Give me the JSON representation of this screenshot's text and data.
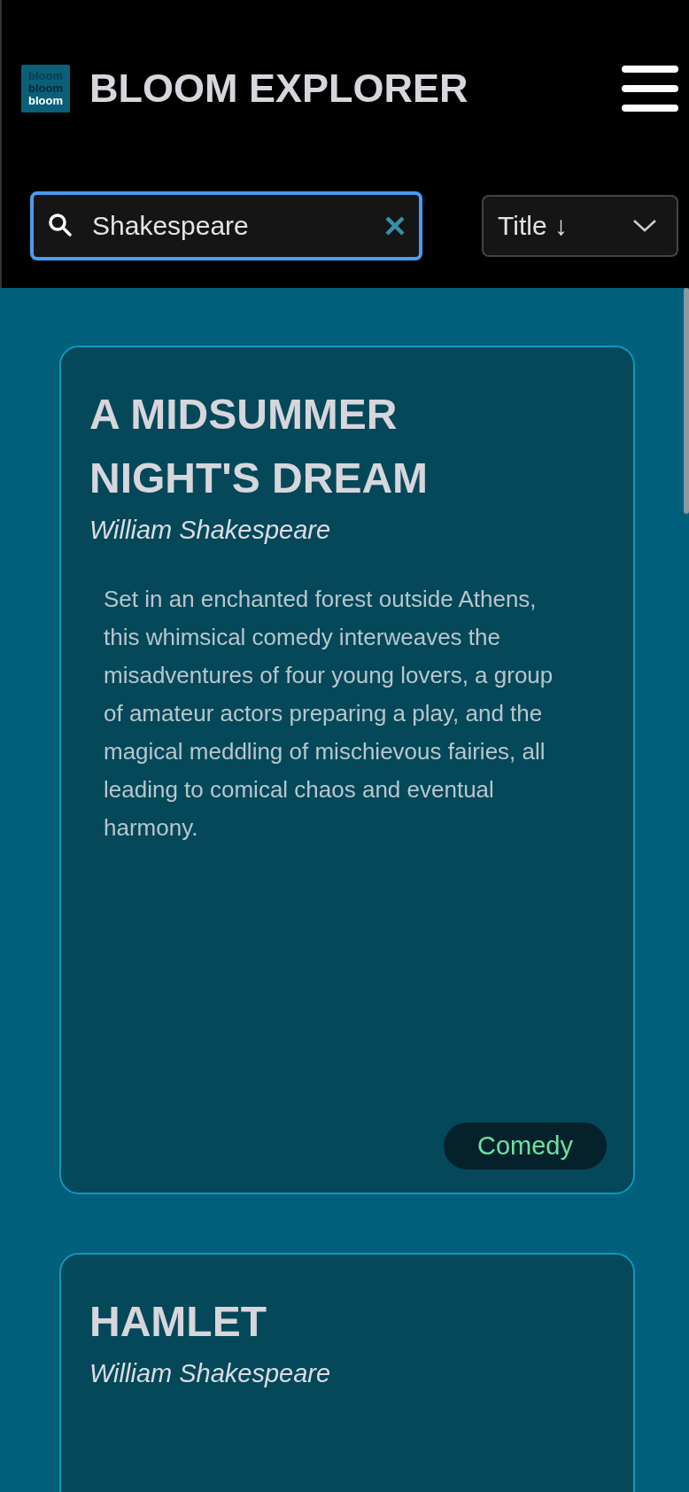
{
  "header": {
    "logo_words": [
      "bloom",
      "bloom",
      "bloom"
    ],
    "title": "BLOOM EXPLORER"
  },
  "search": {
    "value": "Shakespeare"
  },
  "sort": {
    "value": "Title ↓"
  },
  "cards": [
    {
      "title": "A MIDSUMMER NIGHT'S DREAM",
      "author": "William Shakespeare",
      "description": "Set in an enchanted forest outside Athens, this whimsical comedy interweaves the misadventures of four young lovers, a group of amateur actors preparing a play, and the magical meddling of mischievous fairies, all leading to comical chaos and eventual harmony.",
      "genre": "Comedy"
    },
    {
      "title": "HAMLET",
      "author": "William Shakespeare"
    }
  ]
}
